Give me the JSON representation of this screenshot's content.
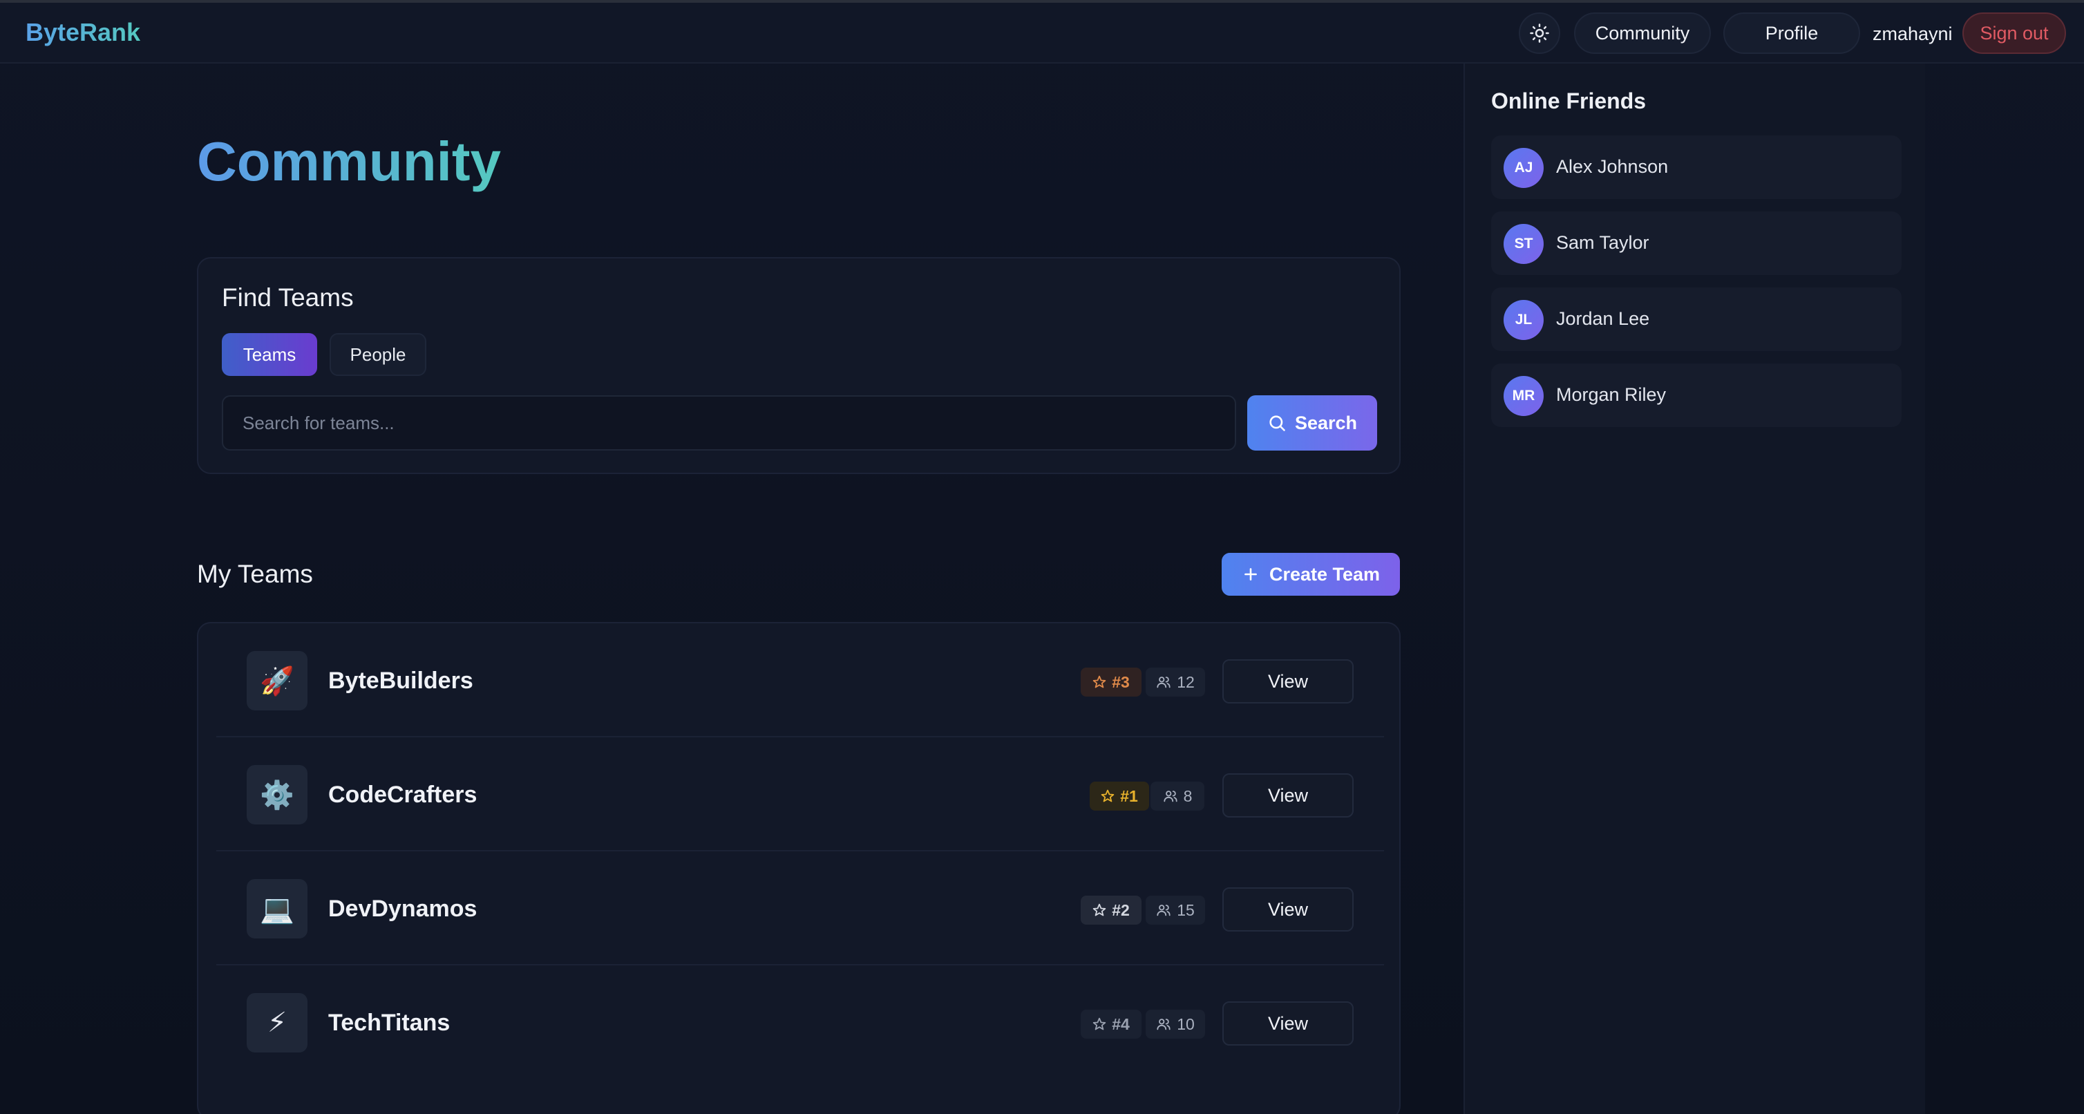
{
  "app": {
    "brand": "ByteRank"
  },
  "header": {
    "theme_icon": "sun-icon",
    "nav": {
      "community": "Community",
      "profile": "Profile"
    },
    "username": "zmahayni",
    "signout_label": "Sign out"
  },
  "main": {
    "title": "Community",
    "find": {
      "title": "Find Teams",
      "tabs": [
        {
          "label": "Teams",
          "active": true
        },
        {
          "label": "People",
          "active": false
        }
      ],
      "search_placeholder": "Search for teams...",
      "search_value": "",
      "search_label": "Search"
    },
    "my_teams": {
      "title": "My Teams",
      "create_label": "Create Team",
      "view_label": "View",
      "teams": [
        {
          "icon": "🚀",
          "icon_name": "rocket-icon",
          "name": "ByteBuilders",
          "rank": "#3",
          "rank_color": "#e08a4a",
          "rank_bg": "#2f2222",
          "members": "12"
        },
        {
          "icon": "⚙️",
          "icon_name": "gear-icon",
          "name": "CodeCrafters",
          "rank": "#1",
          "rank_color": "#e8b22c",
          "rank_bg": "#2c2718",
          "members": "8"
        },
        {
          "icon": "💻",
          "icon_name": "laptop-icon",
          "name": "DevDynamos",
          "rank": "#2",
          "rank_color": "#d4d8e0",
          "rank_bg": "#232938",
          "members": "15"
        },
        {
          "icon": "⚡",
          "icon_name": "lightning-icon",
          "name": "TechTitans",
          "rank": "#4",
          "rank_color": "#9aa1b0",
          "rank_bg": "#1a2131",
          "members": "10"
        }
      ]
    }
  },
  "sidebar": {
    "title": "Online Friends",
    "friends": [
      {
        "initials": "AJ",
        "name": "Alex Johnson"
      },
      {
        "initials": "ST",
        "name": "Sam Taylor"
      },
      {
        "initials": "JL",
        "name": "Jordan Lee"
      },
      {
        "initials": "MR",
        "name": "Morgan Riley"
      }
    ]
  }
}
